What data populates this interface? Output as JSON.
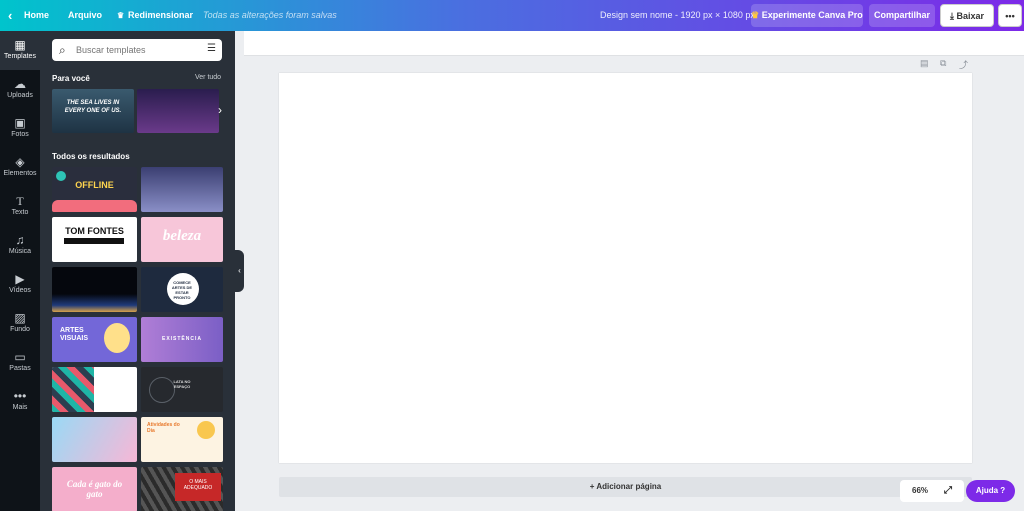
{
  "topbar": {
    "back_icon": "chevron-left-icon",
    "home": "Home",
    "file": "Arquivo",
    "resize_icon": "crown-icon",
    "resize": "Redimensionar",
    "saved": "Todas as alterações foram salvas",
    "design_title": "Design sem nome - 1920 px × 1080 px",
    "pro": "Experimente Canva Pro",
    "share": "Compartilhar",
    "download": "Baixar",
    "more": "•••"
  },
  "rail": [
    {
      "label": "Templates",
      "icon": "templates-icon"
    },
    {
      "label": "Uploads",
      "icon": "cloud-upload-icon"
    },
    {
      "label": "Fotos",
      "icon": "image-icon"
    },
    {
      "label": "Elementos",
      "icon": "shapes-icon"
    },
    {
      "label": "Texto",
      "icon": "text-icon"
    },
    {
      "label": "Música",
      "icon": "music-icon"
    },
    {
      "label": "Vídeos",
      "icon": "video-icon"
    },
    {
      "label": "Fundo",
      "icon": "background-icon"
    },
    {
      "label": "Pastas",
      "icon": "folder-icon"
    },
    {
      "label": "Mais",
      "icon": "more-icon"
    }
  ],
  "panel": {
    "search_placeholder": "Buscar templates",
    "for_you": "Para você",
    "see_all": "Ver tudo",
    "all_results": "Todos os resultados"
  },
  "featured": {
    "sea": "THE SEA LIVES IN EVERY ONE OF US."
  },
  "templates": {
    "offline": "OFFLINE",
    "tom_fontes": "TOM FONTES",
    "beleza": "beleza",
    "comece": "COMECE ARTES DE ESTAR PRONTO",
    "artes_visuais": "ARTES VISUAIS",
    "existencia": "EXISTÊNCIA",
    "espaco": "LATA NO ESPAÇO",
    "atividades": "Atividades do Dia",
    "cada_gato": "Cada é gato do gato",
    "mais_adequado": "O MAIS ADEQUADO"
  },
  "canvas": {
    "add_page": "+ Adicionar página",
    "zoom": "66%",
    "help": "Ajuda",
    "help_mark": "?"
  },
  "colors": {
    "accent": "#7d2ae8",
    "teal": "#00c4cc",
    "panel_bg": "#293039",
    "rail_bg": "#0e1318"
  }
}
